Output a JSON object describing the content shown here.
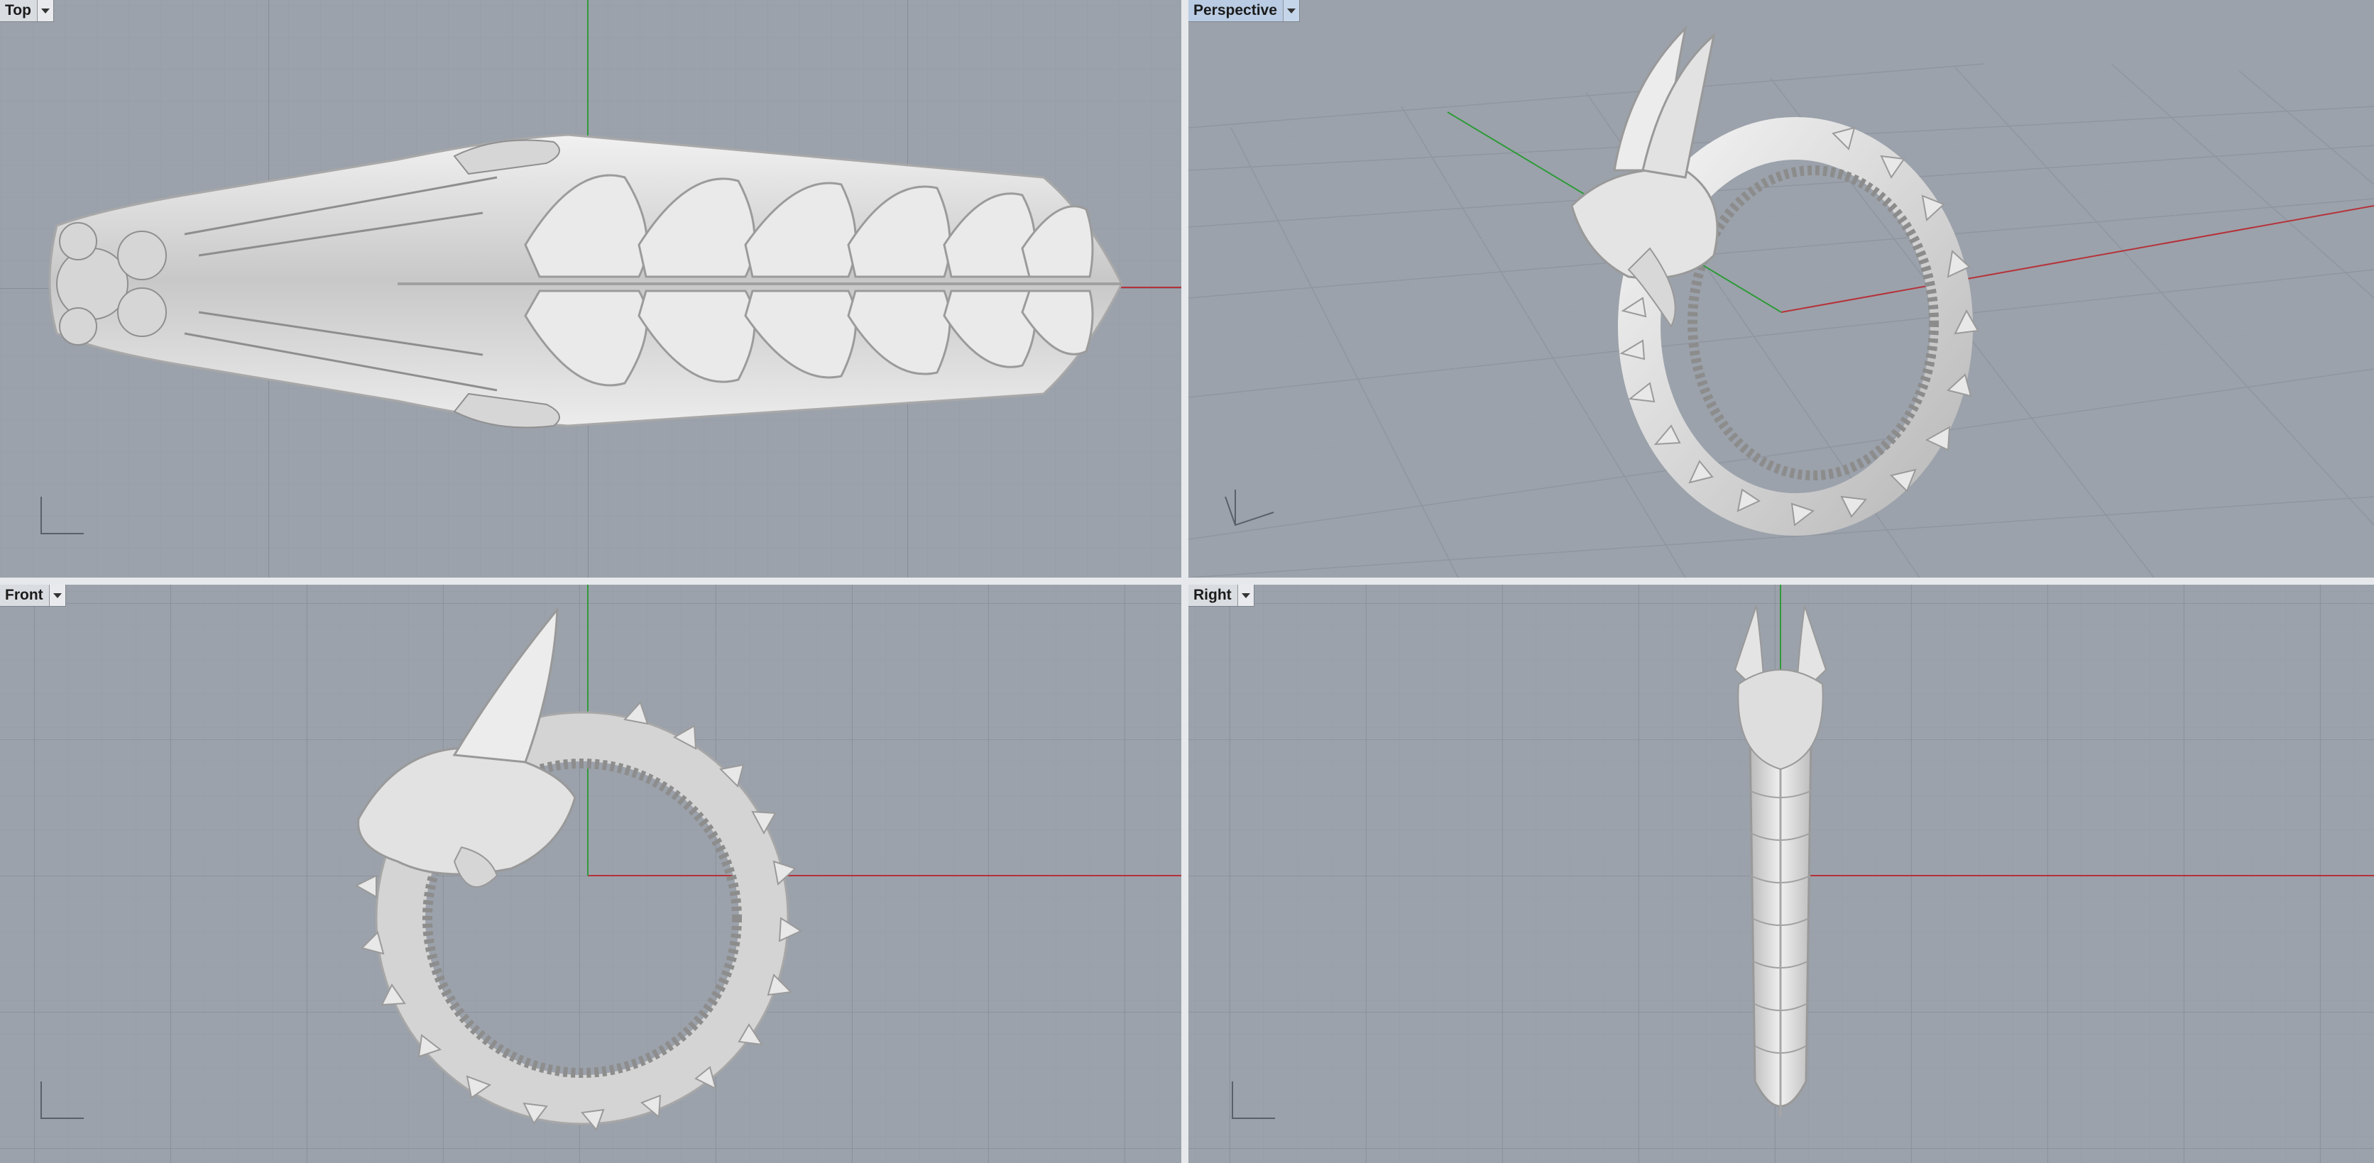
{
  "viewports": {
    "top": {
      "label": "Top",
      "active": false
    },
    "perspective": {
      "label": "Perspective",
      "active": true
    },
    "front": {
      "label": "Front",
      "active": false
    },
    "right": {
      "label": "Right",
      "active": false
    }
  },
  "colors": {
    "viewport_bg": "#9ca2ab",
    "grid_minor": "#939aa3",
    "grid_major": "#878e98",
    "x_axis": "#b5323a",
    "y_axis": "#2f9a3a",
    "model": "#dcdcdc",
    "model_shade": "#9d9d9d",
    "active_label_bg": "#b9cce3"
  },
  "icons": {
    "dropdown": "triangle-down",
    "axes": "world-axes-indicator"
  },
  "model": "dragon ring"
}
